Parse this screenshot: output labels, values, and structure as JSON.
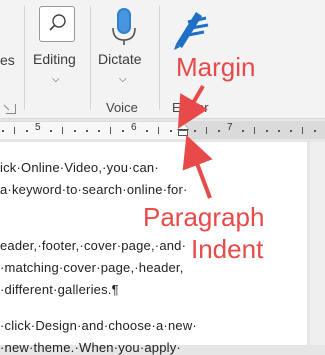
{
  "ribbon": {
    "partial_left_text": "es",
    "editing_label": "Editing",
    "dictate_label": "Dictate",
    "voice_group_label": "Voice",
    "editor_group_label_partial": "Ed itor"
  },
  "ruler": {
    "numbers": [
      "5",
      "6",
      "7"
    ]
  },
  "document": {
    "lines": [
      "ick·Online·Video,·you·can·",
      "a·keyword·to·search·online·for·",
      "",
      "eader,·footer,·cover·page,·and·",
      "·matching·cover·page,·header,",
      "·different·galleries.¶",
      "",
      "·click·Design·and·choose·a·new·",
      "·new·theme.·When·you·apply·"
    ]
  },
  "annotations": {
    "margin": "Margin",
    "paragraph": "Paragraph",
    "indent": "Indent",
    "color": "#e84a4a"
  },
  "colors": {
    "accent_blue": "#1e6fc5",
    "annotation_red": "#e84a4a"
  }
}
